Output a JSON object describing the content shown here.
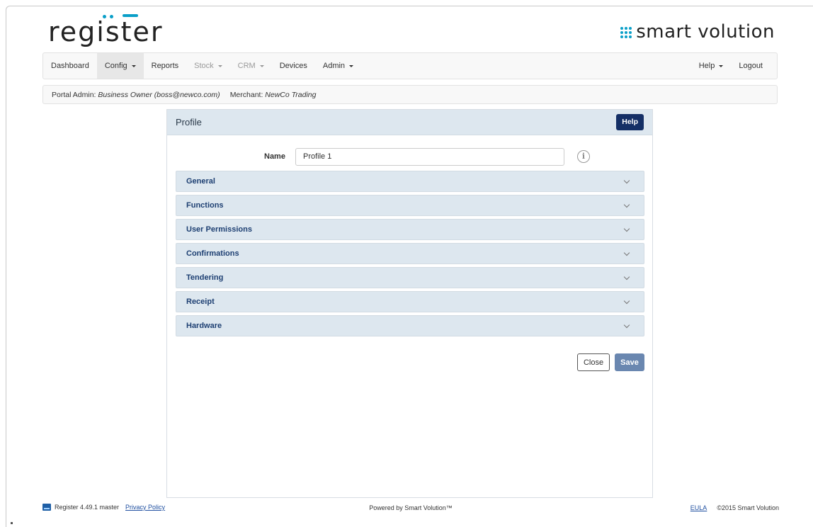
{
  "brand": {
    "app_logo": "register",
    "company_logo": "smart volution"
  },
  "navbar": {
    "items": [
      {
        "label": "Dashboard"
      },
      {
        "label": "Config"
      },
      {
        "label": "Reports"
      },
      {
        "label": "Stock"
      },
      {
        "label": "CRM"
      },
      {
        "label": "Devices"
      },
      {
        "label": "Admin"
      }
    ],
    "right": [
      {
        "label": "Help"
      },
      {
        "label": "Logout"
      }
    ]
  },
  "context": {
    "portal_label": "Portal Admin:",
    "portal_value": "Business Owner (boss@newco.com)",
    "merchant_label": "Merchant:",
    "merchant_value": "NewCo Trading"
  },
  "panel": {
    "title": "Profile",
    "help_label": "Help",
    "name_label": "Name",
    "name_value": "Profile 1",
    "sections": [
      {
        "label": "General"
      },
      {
        "label": "Functions"
      },
      {
        "label": "User Permissions"
      },
      {
        "label": "Confirmations"
      },
      {
        "label": "Tendering"
      },
      {
        "label": "Receipt"
      },
      {
        "label": "Hardware"
      }
    ],
    "close_label": "Close",
    "save_label": "Save"
  },
  "footer": {
    "version": "Register 4.49.1 master",
    "privacy": "Privacy Policy",
    "powered": "Powered by Smart Volution™",
    "eula": "EULA",
    "copyright": "©2015 Smart Volution"
  },
  "colors": {
    "accent": "#0a9fc8",
    "help_button": "#142f66",
    "section_bg": "#dde7ef",
    "section_text": "#1d3f72",
    "save_button": "#6a87b0"
  }
}
